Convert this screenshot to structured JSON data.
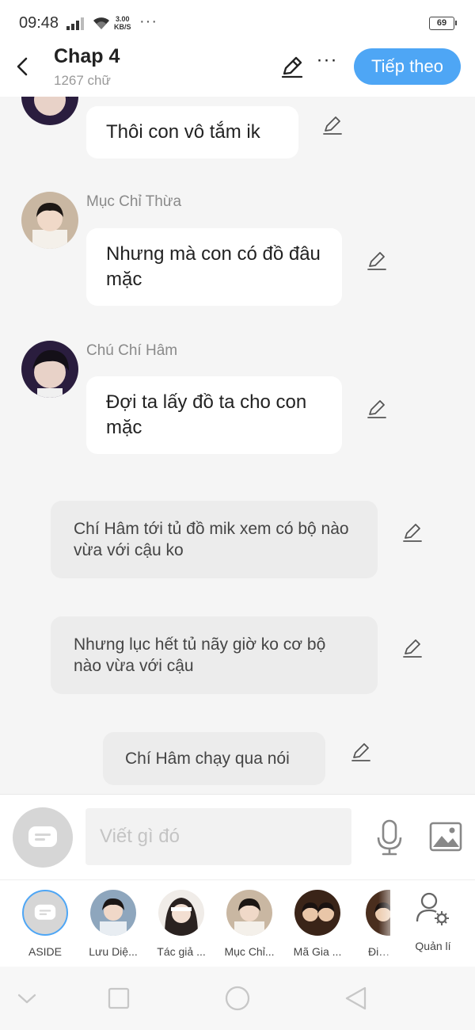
{
  "status": {
    "time": "09:48",
    "speed_value": "3.00",
    "speed_unit": "KB/S",
    "dots": "···",
    "battery": "69"
  },
  "header": {
    "title": "Chap 4",
    "word_count": "1267 chữ",
    "next_label": "Tiếp theo"
  },
  "messages": [
    {
      "text": "Thôi con vô tắm ik"
    },
    {
      "sender": "Mục Chỉ Thừa",
      "text": "Nhưng mà con có đồ đâu mặc"
    },
    {
      "sender": "Chú Chí Hâm",
      "text": "Đợi ta lấy đồ ta cho con mặc"
    }
  ],
  "narrations": [
    "Chí Hâm tới tủ đồ mik xem có bộ nào vừa với cậu ko",
    "Nhưng lục hết tủ nãy giờ ko cơ bộ nào vừa với cậu",
    "Chí Hâm chạy qua nói"
  ],
  "input": {
    "placeholder": "Viết gì đó"
  },
  "characters": [
    {
      "label": "ASIDE"
    },
    {
      "label": "Lưu Diệ..."
    },
    {
      "label": "Tác giả ..."
    },
    {
      "label": "Mục Chỉ..."
    },
    {
      "label": "Mã Gia ..."
    },
    {
      "label": "Đinh T"
    }
  ],
  "manage_label": "Quản lí",
  "colors": {
    "accent": "#4ea6f5",
    "bubble": "#ffffff",
    "narration": "#ececec",
    "background": "#f5f5f5"
  }
}
